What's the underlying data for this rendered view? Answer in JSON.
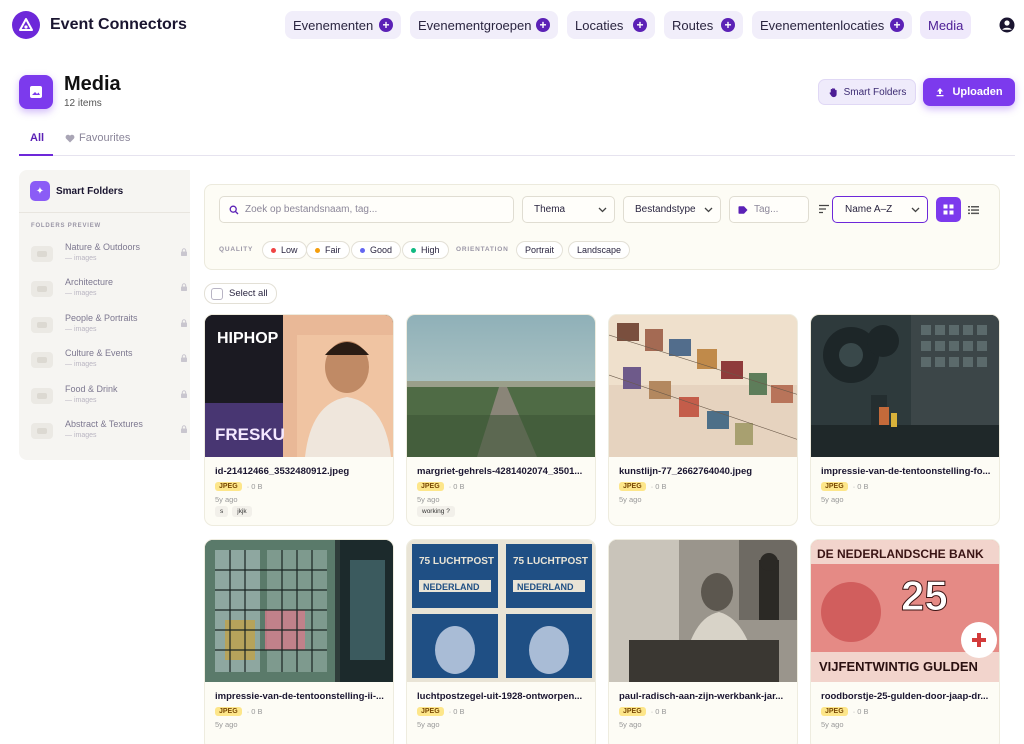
{
  "app": {
    "name": "Event Connectors"
  },
  "nav": {
    "items": [
      {
        "label": "Evenementen"
      },
      {
        "label": "Evenementgroepen"
      },
      {
        "label": "Locaties"
      },
      {
        "label": "Routes"
      },
      {
        "label": "Evenementenlocaties"
      }
    ],
    "active": "Media"
  },
  "header": {
    "title": "Media",
    "count": "12 items",
    "smart_folders_button": "Smart Folders",
    "upload_button": "Uploaden"
  },
  "tabs": {
    "all": "All",
    "favourites": "Favourites"
  },
  "sidebar": {
    "title": "Smart Folders",
    "preview_label": "FOLDERS PREVIEW",
    "folders": [
      {
        "name": "Nature & Outdoors",
        "sub": "— images"
      },
      {
        "name": "Architecture",
        "sub": "— images"
      },
      {
        "name": "People & Portraits",
        "sub": "— images"
      },
      {
        "name": "Culture & Events",
        "sub": "— images"
      },
      {
        "name": "Food & Drink",
        "sub": "— images"
      },
      {
        "name": "Abstract & Textures",
        "sub": "— images"
      }
    ]
  },
  "filters": {
    "search_placeholder": "Zoek op bestandsnaam, tag...",
    "theme": "Thema",
    "filetype": "Bestandstype",
    "tag_placeholder": "Tag...",
    "sort": "Name A–Z",
    "quality_label": "QUALITY",
    "quality": [
      {
        "label": "Low",
        "color": "#ef4444"
      },
      {
        "label": "Fair",
        "color": "#f59e0b"
      },
      {
        "label": "Good",
        "color": "#6366f1"
      },
      {
        "label": "High",
        "color": "#10b981"
      }
    ],
    "orientation_label": "ORIENTATION",
    "orientation": [
      "Portrait",
      "Landscape"
    ]
  },
  "select_all": "Select all",
  "cards": [
    {
      "name": "id-21412466_3532480912.jpeg",
      "type": "JPEG",
      "size": "· 0 B",
      "age": "5y ago",
      "tags": [
        "s",
        "jkjk"
      ]
    },
    {
      "name": "margriet-gehrels-4281402074_3501...",
      "type": "JPEG",
      "size": "· 0 B",
      "age": "5y ago",
      "tags": [
        "working ?"
      ]
    },
    {
      "name": "kunstlijn-77_2662764040.jpeg",
      "type": "JPEG",
      "size": "· 0 B",
      "age": "5y ago",
      "tags": []
    },
    {
      "name": "impressie-van-de-tentoonstelling-fo...",
      "type": "JPEG",
      "size": "· 0 B",
      "age": "5y ago",
      "tags": []
    },
    {
      "name": "impressie-van-de-tentoonstelling-ii-...",
      "type": "JPEG",
      "size": "· 0 B",
      "age": "5y ago",
      "tags": []
    },
    {
      "name": "luchtpostzegel-uit-1928-ontworpen...",
      "type": "JPEG",
      "size": "· 0 B",
      "age": "5y ago",
      "tags": []
    },
    {
      "name": "paul-radisch-aan-zijn-werkbank-jar...",
      "type": "JPEG",
      "size": "· 0 B",
      "age": "5y ago",
      "tags": []
    },
    {
      "name": "roodborstje-25-gulden-door-jaap-dr...",
      "type": "JPEG",
      "size": "· 0 B",
      "age": "5y ago",
      "tags": []
    }
  ],
  "image_text": {
    "hiphop_top": "HIPHOP",
    "hiphop_bottom": "FRESKU",
    "stamp_top": "75 LUCHTPOST",
    "stamp_name": "NEDERLAND",
    "banknote_top": "DE NEDERLANDSCHE BANK",
    "banknote_value": "25",
    "banknote_bottom": "VIJFENTWINTIG GULDEN"
  },
  "colors": {
    "accent": "#7c3aed",
    "accent_dark": "#5b21b6",
    "badge": "#fde68a"
  }
}
